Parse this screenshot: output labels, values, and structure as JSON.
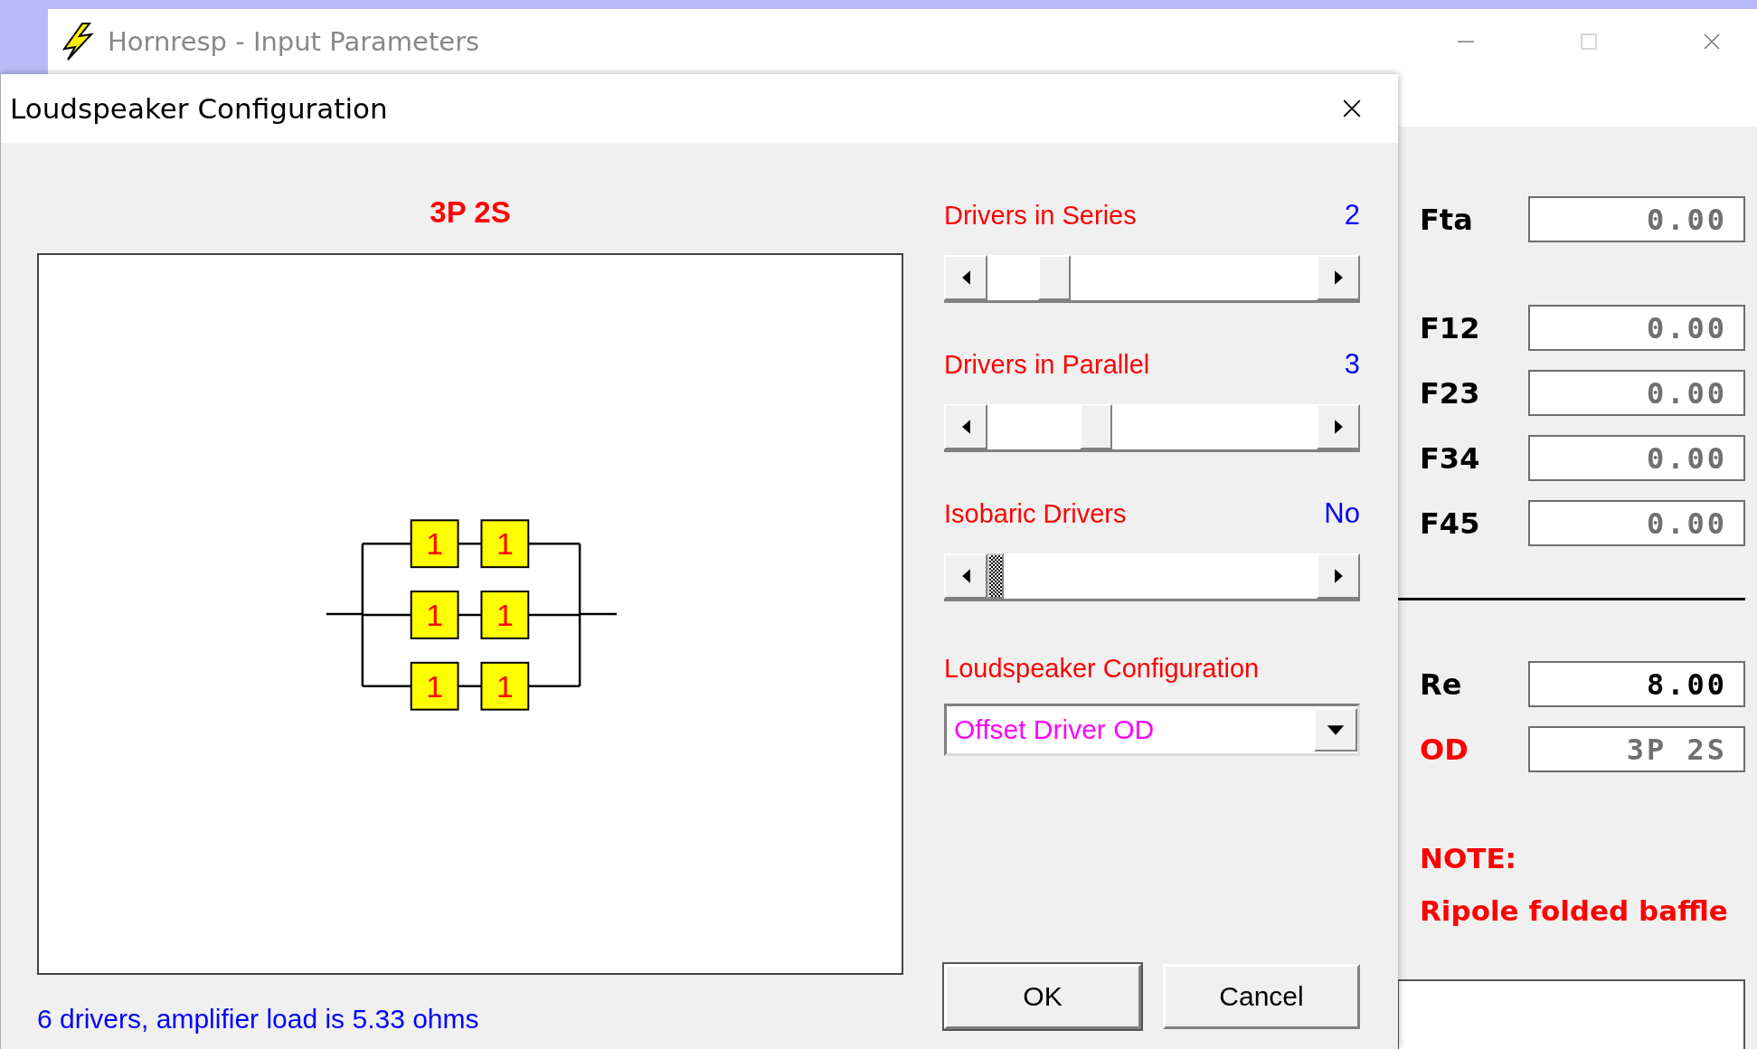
{
  "main_window": {
    "title": "Hornresp - Input Parameters",
    "groups": [
      {
        "fields": [
          {
            "label": "Fta",
            "value": "0.00",
            "dimmed": true,
            "emphasized": false
          }
        ]
      },
      {
        "fields": [
          {
            "label": "F12",
            "value": "0.00",
            "dimmed": true,
            "emphasized": false
          },
          {
            "label": "F23",
            "value": "0.00",
            "dimmed": true,
            "emphasized": false
          },
          {
            "label": "F34",
            "value": "0.00",
            "dimmed": true,
            "emphasized": false
          },
          {
            "label": "F45",
            "value": "0.00",
            "dimmed": true,
            "emphasized": false
          }
        ]
      },
      {
        "fields": [
          {
            "label": "Re",
            "value": "8.00",
            "dimmed": false,
            "emphasized": false
          },
          {
            "label": "OD",
            "value": "3P 2S",
            "dimmed": true,
            "emphasized": true
          }
        ]
      }
    ],
    "note": {
      "heading": "NOTE:",
      "text": "Ripole folded baffle"
    }
  },
  "dialog": {
    "title": "Loudspeaker Configuration",
    "diagram": {
      "title": "3P 2S",
      "rows": [
        [
          "1",
          "1"
        ],
        [
          "1",
          "1"
        ],
        [
          "1",
          "1"
        ]
      ]
    },
    "sliders": [
      {
        "label": "Drivers in Series",
        "reading": "2",
        "level": 0.17,
        "focused": false
      },
      {
        "label": "Drivers in Parallel",
        "reading": "3",
        "level": 0.31,
        "focused": false
      },
      {
        "label": "Isobaric Drivers",
        "reading": "No",
        "level": 0,
        "focused": true
      }
    ],
    "config": {
      "label": "Loudspeaker Configuration",
      "value": "Offset Driver OD"
    },
    "buttons": [
      {
        "label": "OK",
        "default": true
      },
      {
        "label": "Cancel",
        "default": false
      }
    ],
    "status": "6 drivers, amplifier load is 5.33 ohms"
  }
}
